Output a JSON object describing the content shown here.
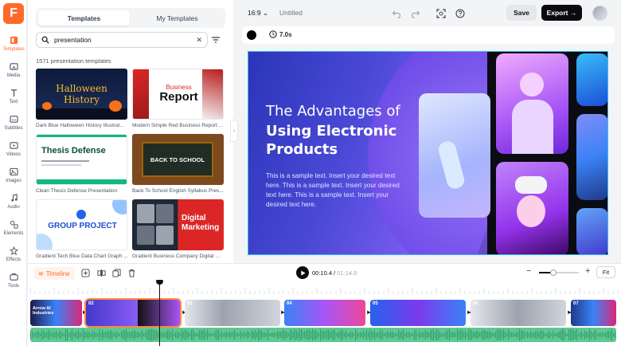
{
  "app": {
    "logo_letter": "F",
    "accent": "#ff6a2b"
  },
  "rail": [
    {
      "label": "Templates",
      "icon": "templates-icon"
    },
    {
      "label": "Media",
      "icon": "media-icon"
    },
    {
      "label": "Text",
      "icon": "text-icon"
    },
    {
      "label": "Subtitles",
      "icon": "subtitles-icon"
    },
    {
      "label": "Videos",
      "icon": "videos-icon"
    },
    {
      "label": "Images",
      "icon": "images-icon"
    },
    {
      "label": "Audio",
      "icon": "audio-icon"
    },
    {
      "label": "Elements",
      "icon": "elements-icon"
    },
    {
      "label": "Effects",
      "icon": "effects-icon"
    },
    {
      "label": "Tools",
      "icon": "tools-icon"
    }
  ],
  "panel": {
    "tabs": [
      "Templates",
      "My Templates"
    ],
    "search_value": "presentation",
    "result_count": "1571 presentation templates",
    "templates": [
      {
        "caption": "Dark Blue Halloween History Illustrat...",
        "line1": "Halloween",
        "line2": "History"
      },
      {
        "caption": "Modern Simple Red Business Report ...",
        "line1": "Business",
        "line2": "Report"
      },
      {
        "caption": "Clean Thesis Defense Presentation",
        "line1": "Thesis Defense",
        "line2": ""
      },
      {
        "caption": "Back To School English Syllabus Pres...",
        "line1": "BACK TO SCHOOL",
        "line2": ""
      },
      {
        "caption": "Gradient Tech Blue Data Chart Graph ...",
        "line1": "GROUP PROJECT",
        "line2": ""
      },
      {
        "caption": "Gradient Business Company Digital ...",
        "line1": "Digital",
        "line2": "Marketing"
      }
    ]
  },
  "topbar": {
    "ratio": "16:9",
    "title": "Untitled",
    "save": "Save",
    "export": "Export"
  },
  "canvas_toolbar": {
    "duration": "7.0s"
  },
  "slide": {
    "title_line1": "The Advantages of",
    "title_line2": "Using Electronic Products",
    "body": "This is a sample text. Insert your desired text here. This is a sample text. Insert your desired text here. This is a sample text. Insert your desired text here."
  },
  "timeline": {
    "tab": "Timeline",
    "current_time": "00:10.4",
    "total_time": "01:14.0",
    "fit": "Fit",
    "zoom_level": 0.35,
    "clips": [
      {
        "num": "",
        "title": "Arrow AI Industries"
      },
      {
        "num": "02",
        "title": ""
      },
      {
        "num": "03",
        "title": ""
      },
      {
        "num": "04",
        "title": ""
      },
      {
        "num": "05",
        "title": ""
      },
      {
        "num": "06",
        "title": ""
      },
      {
        "num": "07",
        "title": ""
      }
    ]
  }
}
